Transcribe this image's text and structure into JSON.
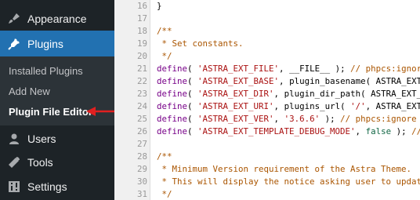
{
  "sidebar": {
    "appearance": {
      "label": "Appearance",
      "icon": "paintbrush-icon"
    },
    "plugins": {
      "label": "Plugins",
      "icon": "plugin-icon"
    },
    "submenu": {
      "installed": "Installed Plugins",
      "add_new": "Add New",
      "file_editor": "Plugin File Editor"
    },
    "users": {
      "label": "Users",
      "icon": "users-icon"
    },
    "tools": {
      "label": "Tools",
      "icon": "wrench-icon"
    },
    "settings": {
      "label": "Settings",
      "icon": "settings-icon"
    }
  },
  "colors": {
    "sidebar_bg": "#1d2327",
    "active_bg": "#2271b1",
    "arrow": "#e02020"
  },
  "editor": {
    "lines": [
      {
        "n": "16",
        "t": "}"
      },
      {
        "n": "17",
        "t": ""
      },
      {
        "n": "18",
        "t": "/**"
      },
      {
        "n": "19",
        "t": " * Set constants."
      },
      {
        "n": "20",
        "t": " */"
      },
      {
        "n": "21",
        "t": "define( 'ASTRA_EXT_FILE', __FILE__ ); // phpcs:ignore"
      },
      {
        "n": "22",
        "t": "define( 'ASTRA_EXT_BASE', plugin_basename( ASTRA_EXT_"
      },
      {
        "n": "23",
        "t": "define( 'ASTRA_EXT_DIR', plugin_dir_path( ASTRA_EXT_F"
      },
      {
        "n": "24",
        "t": "define( 'ASTRA_EXT_URI', plugins_url( '/', ASTRA_EXT_"
      },
      {
        "n": "25",
        "t": "define( 'ASTRA_EXT_VER', '3.6.6' ); // phpcs:ignore W"
      },
      {
        "n": "26",
        "t": "define( 'ASTRA_EXT_TEMPLATE_DEBUG_MODE', false ); //"
      },
      {
        "n": "27",
        "t": ""
      },
      {
        "n": "28",
        "t": "/**"
      },
      {
        "n": "29",
        "t": " * Minimum Version requirement of the Astra Theme."
      },
      {
        "n": "30",
        "t": " * This will display the notice asking user to update"
      },
      {
        "n": "31",
        "t": " */"
      }
    ]
  }
}
